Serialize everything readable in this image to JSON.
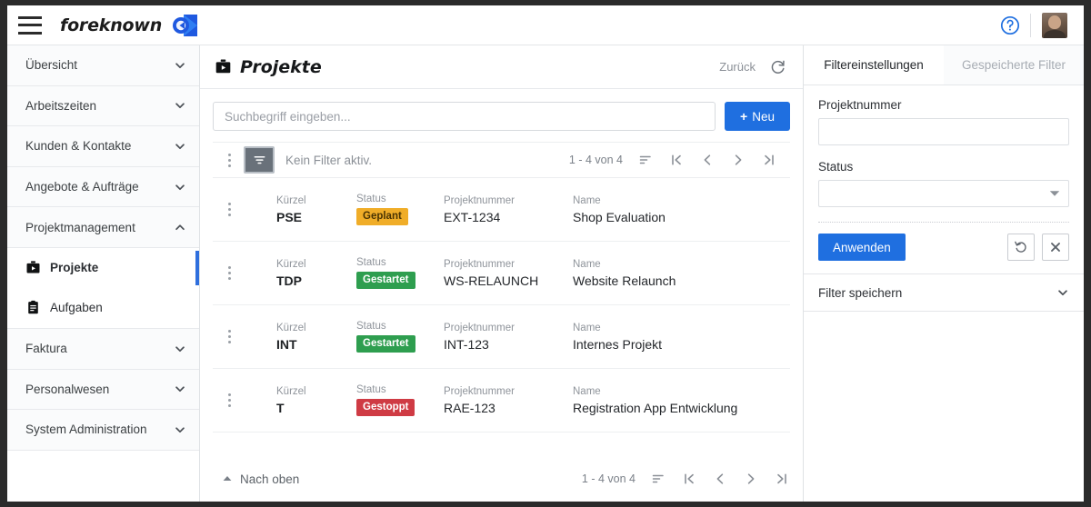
{
  "app": {
    "brand_name": "foreknown",
    "menu_icon": "hamburger-icon",
    "help_icon": "help-circle-icon",
    "avatar_icon": "user-avatar"
  },
  "sidebar": {
    "items": [
      {
        "label": "Übersicht",
        "state": "collapsed",
        "icon": "chevron-down-icon"
      },
      {
        "label": "Arbeitszeiten",
        "state": "collapsed",
        "icon": "chevron-down-icon"
      },
      {
        "label": "Kunden & Kontakte",
        "state": "collapsed",
        "icon": "chevron-down-icon"
      },
      {
        "label": "Angebote & Aufträge",
        "state": "collapsed",
        "icon": "chevron-down-icon"
      },
      {
        "label": "Projektmanagement",
        "state": "expanded",
        "icon": "chevron-up-icon"
      }
    ],
    "sub_items": [
      {
        "label": "Projekte",
        "icon": "briefcase-icon",
        "active": true
      },
      {
        "label": "Aufgaben",
        "icon": "clipboard-icon",
        "active": false
      }
    ],
    "items_after": [
      {
        "label": "Faktura",
        "state": "collapsed",
        "icon": "chevron-down-icon"
      },
      {
        "label": "Personalwesen",
        "state": "collapsed",
        "icon": "chevron-down-icon"
      },
      {
        "label": "System Administration",
        "state": "collapsed",
        "icon": "chevron-down-icon"
      }
    ]
  },
  "main": {
    "title": "Projekte",
    "title_icon": "briefcase-icon",
    "back_label": "Zurück",
    "refresh_icon": "refresh-icon",
    "search": {
      "placeholder": "Suchbegriff eingeben...",
      "value": ""
    },
    "new_button": {
      "label": "Neu",
      "plus": "+"
    },
    "filterbar": {
      "kebab_icon": "more-vertical-icon",
      "filter_icon": "filter-icon",
      "filter_status": "Kein Filter aktiv.",
      "count": "1 - 4 von 4",
      "sort_icon": "sort-icon",
      "first_icon": "first-page-icon",
      "prev_icon": "previous-page-icon",
      "next_icon": "next-page-icon",
      "last_icon": "last-page-icon"
    },
    "columns": {
      "kuerzel": "Kürzel",
      "status": "Status",
      "nummer": "Projektnummer",
      "name": "Name"
    },
    "rows": [
      {
        "kuerzel": "PSE",
        "status": "Geplant",
        "status_color": "#f0ad28",
        "status_text_color": "#4a3403",
        "nummer": "EXT-1234",
        "name": "Shop Evaluation"
      },
      {
        "kuerzel": "TDP",
        "status": "Gestartet",
        "status_color": "#2e9e4f",
        "status_text_color": "#ffffff",
        "nummer": "WS-RELAUNCH",
        "name": "Website Relaunch"
      },
      {
        "kuerzel": "INT",
        "status": "Gestartet",
        "status_color": "#2e9e4f",
        "status_text_color": "#ffffff",
        "nummer": "INT-123",
        "name": "Internes Projekt"
      },
      {
        "kuerzel": "T",
        "status": "Gestoppt",
        "status_color": "#cf3b44",
        "status_text_color": "#ffffff",
        "nummer": "RAE-123",
        "name": "Registration App Entwicklung"
      }
    ],
    "footer": {
      "top_label": "Nach oben",
      "top_icon": "chevron-up-icon",
      "count": "1 - 4 von 4",
      "sort_icon": "sort-icon",
      "first_icon": "first-page-icon",
      "prev_icon": "previous-page-icon",
      "next_icon": "next-page-icon",
      "last_icon": "last-page-icon"
    }
  },
  "filter_panel": {
    "tabs": [
      {
        "label": "Filtereinstellungen",
        "active": true
      },
      {
        "label": "Gespeicherte Filter",
        "active": false
      }
    ],
    "fields": {
      "projektnummer_label": "Projektnummer",
      "projektnummer_value": "",
      "projektnummer_placeholder": "",
      "status_label": "Status",
      "status_value": "",
      "status_dropdown_icon": "dropdown-arrow-icon"
    },
    "actions": {
      "apply_label": "Anwenden",
      "reset_icon": "undo-icon",
      "clear_icon": "close-icon"
    },
    "save_section": {
      "label": "Filter speichern",
      "icon": "chevron-down-icon"
    }
  },
  "colors": {
    "accent_blue": "#1f6fe0",
    "logo_blue": "#2458d8",
    "filter_button": "#69717a",
    "sidebar_active_bar": "#2f6fdd"
  }
}
